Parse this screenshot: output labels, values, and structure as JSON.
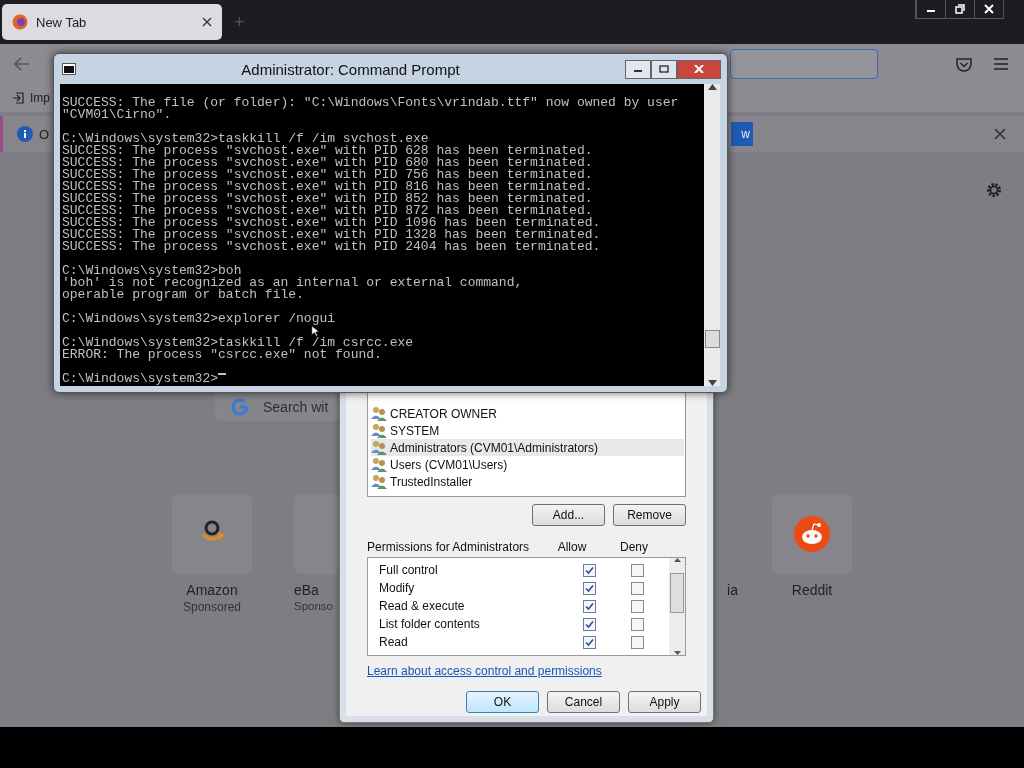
{
  "browser": {
    "tab": {
      "title": "New Tab",
      "new_tab": "+"
    },
    "bookmarks": [
      {
        "label": "Imp"
      }
    ],
    "notice": {
      "text": "O",
      "button": "w"
    },
    "search": {
      "placeholder": "Search wit"
    },
    "shortcuts": [
      {
        "name": "Amazon",
        "sub": "Sponsored",
        "kind": "full"
      },
      {
        "name": "eBa",
        "sub": "Sponso",
        "kind": "cut-right"
      },
      {
        "name": "ia",
        "kind": "cut-left"
      },
      {
        "name": "Reddit",
        "kind": "full"
      }
    ]
  },
  "console": {
    "title": "Administrator: Command Prompt",
    "blocks": [
      [
        "SUCCESS: The file (or folder): \"C:\\Windows\\Fonts\\vrindab.ttf\" now owned by user",
        "\"CVM01\\Cirno\"."
      ],
      [
        "C:\\Windows\\system32>taskkill /f /im svchost.exe",
        "SUCCESS: The process \"svchost.exe\" with PID 628 has been terminated.",
        "SUCCESS: The process \"svchost.exe\" with PID 680 has been terminated.",
        "SUCCESS: The process \"svchost.exe\" with PID 756 has been terminated.",
        "SUCCESS: The process \"svchost.exe\" with PID 816 has been terminated.",
        "SUCCESS: The process \"svchost.exe\" with PID 852 has been terminated.",
        "SUCCESS: The process \"svchost.exe\" with PID 872 has been terminated.",
        "SUCCESS: The process \"svchost.exe\" with PID 1096 has been terminated.",
        "SUCCESS: The process \"svchost.exe\" with PID 1328 has been terminated.",
        "SUCCESS: The process \"svchost.exe\" with PID 2404 has been terminated."
      ],
      [
        "C:\\Windows\\system32>boh",
        "'boh' is not recognized as an internal or external command,",
        "operable program or batch file."
      ],
      [
        "C:\\Windows\\system32>explorer /nogui"
      ],
      [
        "C:\\Windows\\system32>taskkill /f /im csrcc.exe",
        "ERROR: The process \"csrcc.exe\" not found."
      ]
    ],
    "prompt": "C:\\Windows\\system32>"
  },
  "dialog": {
    "principals": [
      {
        "name": "CREATOR OWNER",
        "selected": false
      },
      {
        "name": "SYSTEM",
        "selected": false
      },
      {
        "name": "Administrators (CVM01\\Administrators)",
        "selected": true
      },
      {
        "name": "Users (CVM01\\Users)",
        "selected": false
      },
      {
        "name": "TrustedInstaller",
        "selected": false
      }
    ],
    "buttons": [
      "Add...",
      "Remove"
    ],
    "permissions_label": "Permissions for Administrators",
    "columns": [
      "Allow",
      "Deny"
    ],
    "permissions": [
      {
        "name": "Full control",
        "allow": true,
        "deny": false
      },
      {
        "name": "Modify",
        "allow": true,
        "deny": false
      },
      {
        "name": "Read & execute",
        "allow": true,
        "deny": false
      },
      {
        "name": "List folder contents",
        "allow": true,
        "deny": false
      },
      {
        "name": "Read",
        "allow": true,
        "deny": false
      }
    ],
    "link": "Learn about access control and permissions",
    "footer_buttons": [
      {
        "label": "OK",
        "focused": true
      },
      {
        "label": "Cancel",
        "focused": false
      },
      {
        "label": "Apply",
        "focused": false
      }
    ]
  }
}
